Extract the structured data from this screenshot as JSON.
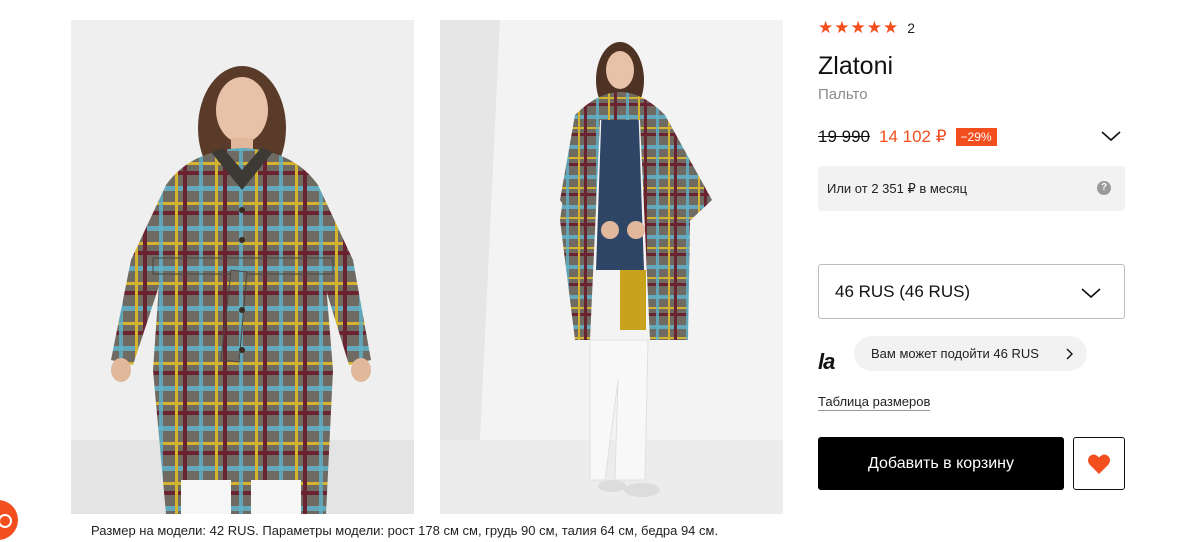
{
  "product": {
    "rating_stars": "★★★★★",
    "rating_count": "2",
    "brand": "Zlatoni",
    "category": "Пальто",
    "old_price": "19 990",
    "new_price": "14 102 ₽",
    "discount": "−29%",
    "installment_text": "Или от 2 351 ₽ в месяц",
    "help_icon": "?",
    "selected_size": "46 RUS (46 RUS)",
    "fit_logo": "la",
    "fit_suggestion": "Вам может подойти 46 RUS",
    "size_table_link": "Таблица размеров",
    "add_to_cart": "Добавить в корзину",
    "model_caption": "Размер на модели: 42 RUS. Параметры модели: рост 178 см см, грудь 90 см, талия 64 см, бедра 94 см."
  },
  "colors": {
    "accent": "#f24e1e",
    "button_bg": "#000000",
    "muted_text": "#8a8a8a",
    "panel_bg": "#f2f2f2"
  },
  "icons": {
    "rating": "star-icon",
    "price_toggle": "chevron-down-icon",
    "help": "question-icon",
    "size_dropdown": "chevron-down-icon",
    "fit_more": "chevron-right-icon",
    "wishlist": "heart-icon"
  }
}
